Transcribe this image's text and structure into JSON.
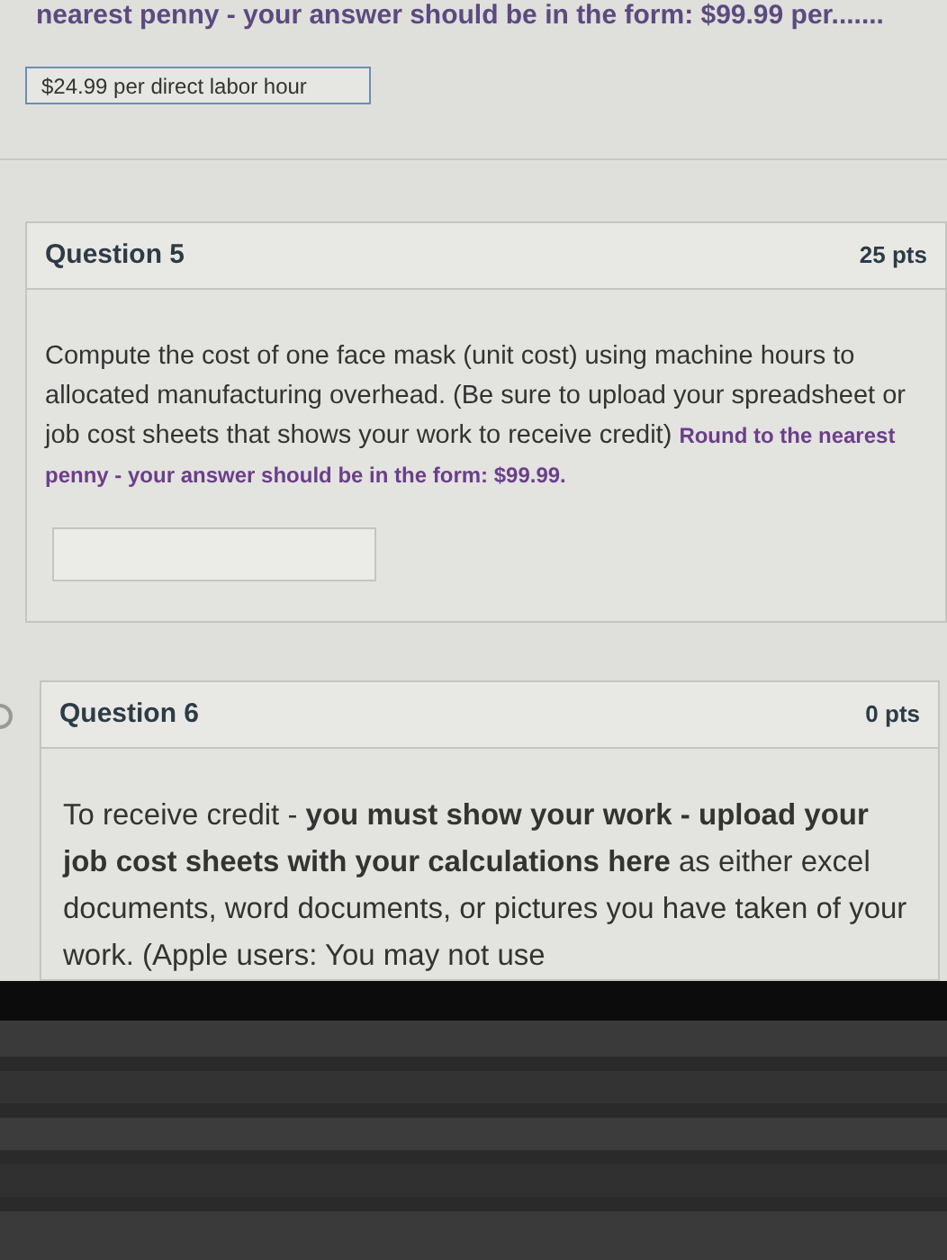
{
  "previous_question": {
    "instruction": "nearest penny - your answer should be in the form:  $99.99 per.......",
    "answer": "$24.99 per direct labor hour"
  },
  "questions": [
    {
      "title": "Question 5",
      "points": "25 pts",
      "text": "Compute the cost of one face mask (unit cost) using machine hours to allocated manufacturing overhead. (Be sure to upload your spreadsheet or job cost sheets that shows your work to receive credit)",
      "instruction": "Round to the nearest penny - your answer should be in the form:  $99.99.",
      "kind": "answer"
    },
    {
      "title": "Question 6",
      "points": "0 pts",
      "text": "To receive credit - **you must show your work - upload your job cost sheets with your calculations here** as either excel documents, word documents, or pictures you have taken of your work.  (Apple users:  You may not use",
      "kind": "upload"
    }
  ]
}
